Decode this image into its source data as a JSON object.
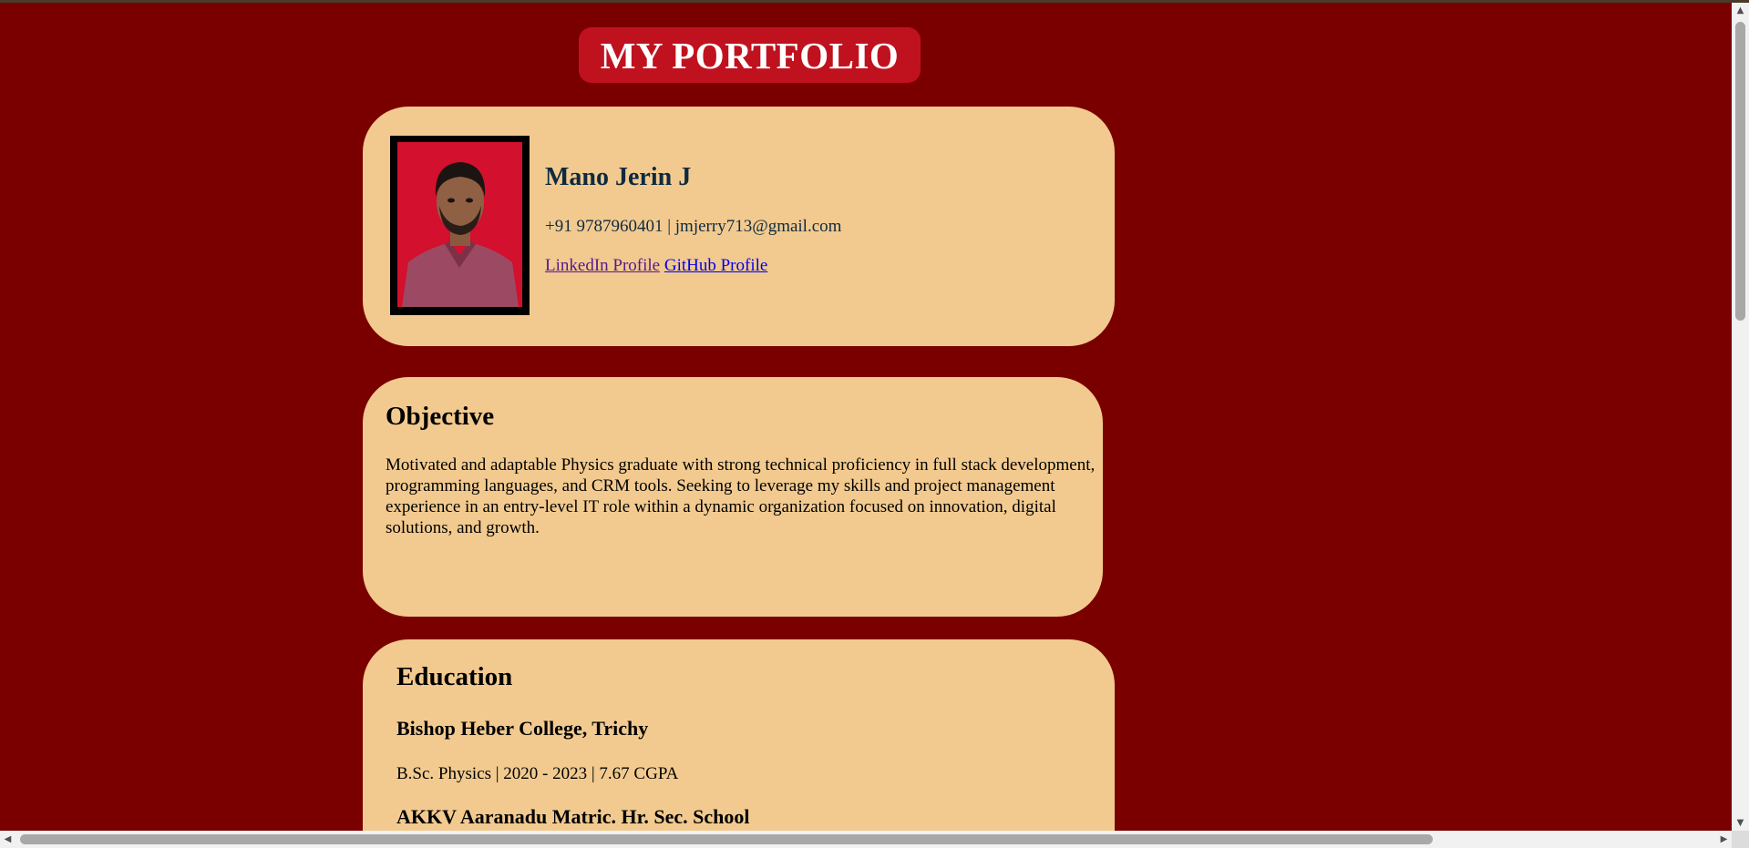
{
  "header": {
    "title": "MY PORTFOLIO"
  },
  "profile": {
    "name": "Mano Jerin J",
    "contact": "+91 9787960401 | jmjerry713@gmail.com",
    "linkedin_label": "LinkedIn Profile",
    "github_label": "GitHub Profile",
    "photo_icon": "profile-photo"
  },
  "objective": {
    "heading": "Objective",
    "text": "Motivated and adaptable Physics graduate with strong technical proficiency in full stack development, programming languages, and CRM tools. Seeking to leverage my skills and project management experience in an entry-level IT role within a dynamic organization focused on innovation, digital solutions, and growth."
  },
  "education": {
    "heading": "Education",
    "entries": [
      {
        "school": "Bishop Heber College, Trichy",
        "detail": "B.Sc. Physics | 2020 - 2023 | 7.67 CGPA"
      },
      {
        "school": "AKKV Aaranadu Matric. Hr. Sec. School",
        "detail": ""
      }
    ]
  },
  "scrollbar": {
    "up_glyph": "▲",
    "down_glyph": "▼",
    "left_glyph": "◀",
    "right_glyph": "▶"
  },
  "colors": {
    "page_background": "#7a0000",
    "title_pill": "#c0121e",
    "card": "#f2ca8f",
    "name_text": "#0f2a3f"
  }
}
